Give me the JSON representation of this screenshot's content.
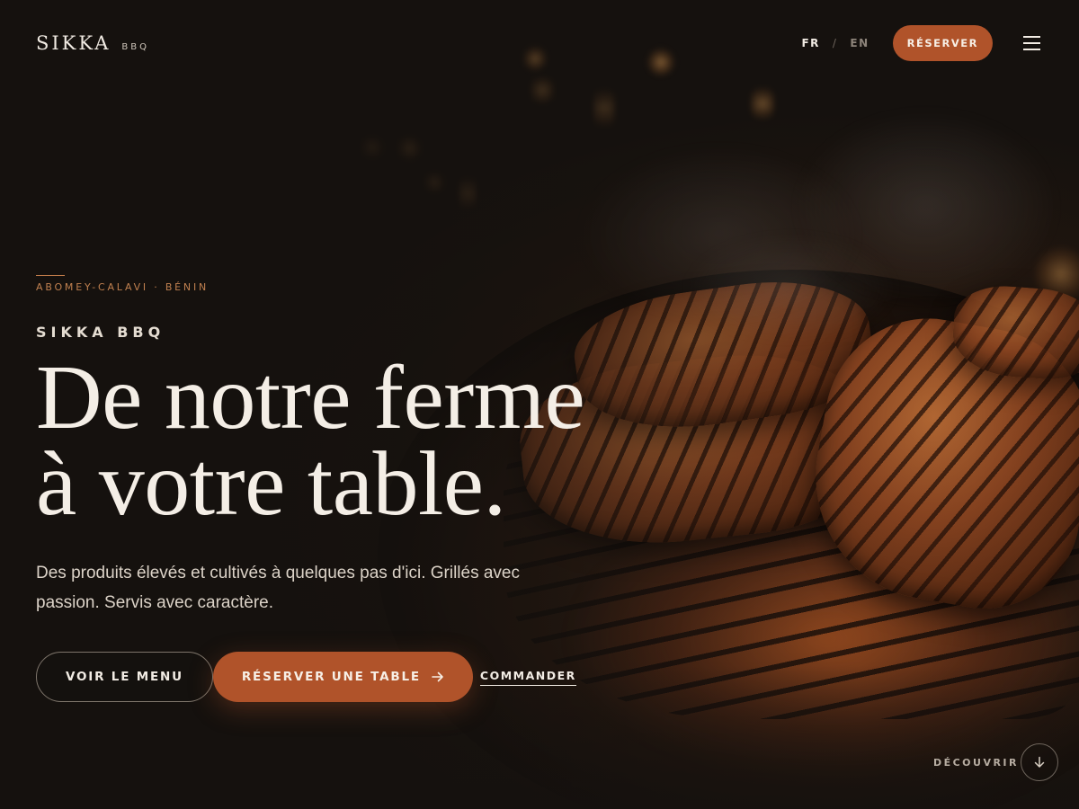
{
  "header": {
    "logo_main": "SIKKA",
    "logo_sub": "BBQ",
    "lang_active": "FR",
    "lang_separator": "/",
    "lang_inactive": "EN",
    "reserve_button": "RÉSERVER",
    "menu_icon": "hamburger-menu-icon"
  },
  "hero": {
    "location": "ABOMEY-CALAVI · BÉNIN",
    "brand": "SIKKA BBQ",
    "headline_line1": "De notre ferme",
    "headline_line2": "à votre table.",
    "tagline": "Des produits élevés et cultivés à quelques pas d'ici. Grillés avec passion. Servis avec caractère.",
    "cta_menu": "VOIR LE MENU",
    "cta_reserve": "RÉSERVER UNE TABLE",
    "cta_reserve_icon": "arrow-right-icon",
    "cta_order": "COMMANDER"
  },
  "discover": {
    "label": "DÉCOUVRIR",
    "icon": "arrow-down-icon"
  },
  "colors": {
    "accent": "#b0532a",
    "background": "#15110e",
    "text": "#f2ece4",
    "location": "#c0804f"
  }
}
